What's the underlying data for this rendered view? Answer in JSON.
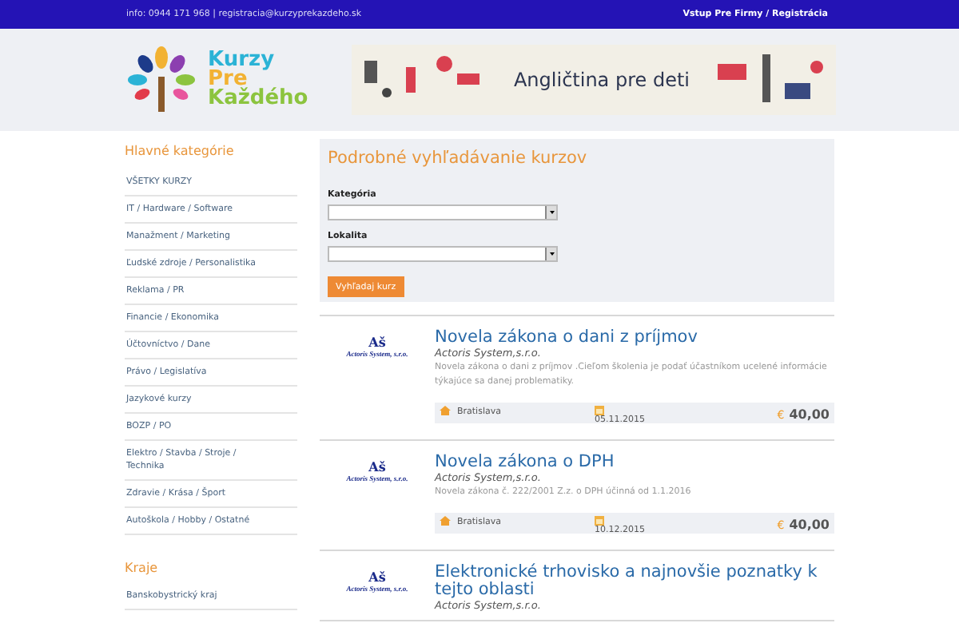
{
  "top_bar": {
    "contact": "info: 0944 171 968 | registracia@kurzyprekazdeho.sk",
    "link": "Vstup Pre Firmy / Registrácia"
  },
  "logo": {
    "lines": [
      "Kurzy",
      "Pre",
      "Každého"
    ]
  },
  "banner": {
    "text": "Angličtina pre deti"
  },
  "sidebar": {
    "sections": [
      {
        "title": "Hlavné kategórie",
        "items": [
          "VŠETKY KURZY",
          "IT / Hardware / Software",
          "Manažment / Marketing",
          "Ľudské zdroje / Personalistika",
          "Reklama / PR",
          "Financie / Ekonomika",
          "Účtovníctvo / Dane",
          "Právo / Legislatíva",
          "Jazykové kurzy",
          "BOZP / PO",
          "Elektro / Stavba / Stroje / Technika",
          "Zdravie / Krása / Šport",
          "Autoškola / Hobby / Ostatné"
        ]
      },
      {
        "title": "Kraje",
        "items": [
          "Banskobystrický kraj"
        ]
      }
    ]
  },
  "search": {
    "title": "Podrobné vyhľadávanie kurzov",
    "fields": [
      {
        "label": "Kategória"
      },
      {
        "label": "Lokalita"
      }
    ],
    "button": "Vyhľadaj kurz"
  },
  "courses": [
    {
      "logo_mark": "Aš",
      "logo_name": "Actoris System, s.r.o.",
      "title": "Novela zákona o dani z príjmov",
      "company": "Actoris System,s.r.o.",
      "description": "Novela zákona o dani z príjmov .Cieľom školenia je podať účastníkom ucelené informácie týkajúce sa danej problematiky.",
      "location": "Bratislava",
      "date": "05.11.2015",
      "price": "40,00",
      "currency": "€"
    },
    {
      "logo_mark": "Aš",
      "logo_name": "Actoris System, s.r.o.",
      "title": "Novela zákona o DPH",
      "company": "Actoris System,s.r.o.",
      "description": "Novela zákona č. 222/2001 Z.z. o DPH účinná od 1.1.2016",
      "location": "Bratislava",
      "date": "10.12.2015",
      "price": "40,00",
      "currency": "€"
    },
    {
      "logo_mark": "Aš",
      "logo_name": "Actoris System, s.r.o.",
      "title": "Elektronické trhovisko a najnovšie poznatky k tejto oblasti",
      "company": "Actoris System,s.r.o."
    }
  ]
}
